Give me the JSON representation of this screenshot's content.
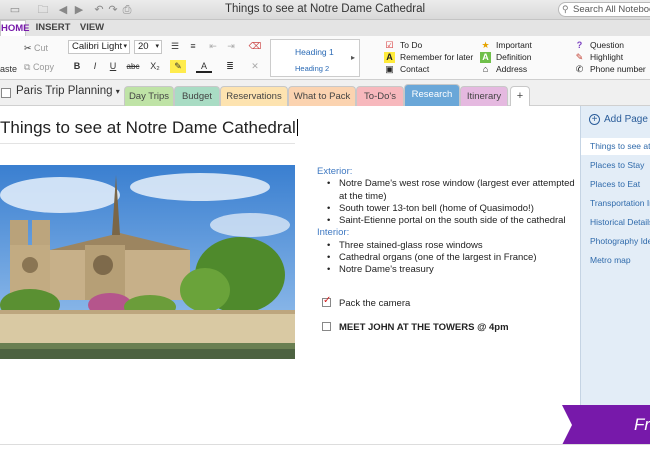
{
  "window": {
    "title": "Things to see at Notre Dame Cathedral",
    "search_placeholder": "Search All Notebooks"
  },
  "ribbon_tabs": [
    "HOME",
    "INSERT",
    "VIEW"
  ],
  "ribbon": {
    "cut": "Cut",
    "copy": "Copy",
    "paste": "aste",
    "font_name": "Calibri Light",
    "font_size": "20",
    "bold": "B",
    "italic": "I",
    "underline": "U",
    "strike": "abc",
    "subscript": "X₂",
    "styles": [
      "Heading 1",
      "Heading 2"
    ],
    "tags": [
      {
        "label": "To Do",
        "icon": "checkbox-icon"
      },
      {
        "label": "Remember for later",
        "icon": "highlight-a-icon"
      },
      {
        "label": "Contact",
        "icon": "contact-card-icon"
      },
      {
        "label": "Important",
        "icon": "star-icon"
      },
      {
        "label": "Definition",
        "icon": "definition-a-icon"
      },
      {
        "label": "Address",
        "icon": "house-icon"
      },
      {
        "label": "Question",
        "icon": "question-mark-icon"
      },
      {
        "label": "Highlight",
        "icon": "pen-icon"
      },
      {
        "label": "Phone number",
        "icon": "phone-icon"
      }
    ]
  },
  "notebook": {
    "name": "Paris Trip Planning",
    "sections": [
      {
        "label": "Day Trips",
        "color": "#bfe3a6"
      },
      {
        "label": "Budget",
        "color": "#a9dcc4"
      },
      {
        "label": "Reservations",
        "color": "#fde3b0"
      },
      {
        "label": "What to Pack",
        "color": "#fbd3b0"
      },
      {
        "label": "To-Do's",
        "color": "#f7b8bd"
      },
      {
        "label": "Research",
        "color": "#6aa7d8"
      },
      {
        "label": "Itinerary",
        "color": "#e5b9e0"
      }
    ],
    "add_section": "+"
  },
  "page": {
    "title": "Things to see at Notre Dame Cathedral",
    "exterior_header": "Exterior:",
    "exterior": [
      "Notre Dame's west rose window (largest ever attempted at the time)",
      "South tower 13-ton bell (home of Quasimodo!)",
      "Saint-Etienne portal on the south side of the cathedral"
    ],
    "interior_header": "Interior:",
    "interior": [
      "Three stained-glass rose windows",
      "Cathedral organs (one of the largest in France)",
      "Notre Dame's treasury"
    ],
    "todos": [
      {
        "label": "Pack the camera",
        "checked": true
      },
      {
        "label": "MEET JOHN AT THE TOWERS @ 4pm",
        "checked": false
      }
    ]
  },
  "pages_pane": {
    "add_page": "Add Page",
    "pages": [
      "Things to see at Notre Dame",
      "Places to Stay",
      "Places to Eat",
      "Transportation Info",
      "Historical Details",
      "Photography Ideas",
      "Metro map"
    ],
    "active_index": 0
  },
  "banner_text": "Fr",
  "colors": {
    "accent": "#7719aa",
    "section_active": "#6aa7d8",
    "link_blue": "#2f6aab"
  }
}
